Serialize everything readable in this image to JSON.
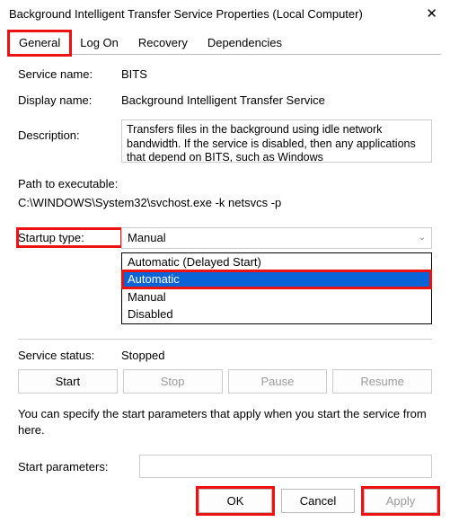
{
  "window": {
    "title": "Background Intelligent Transfer Service Properties (Local Computer)"
  },
  "tabs": {
    "general": "General",
    "logon": "Log On",
    "recovery": "Recovery",
    "dependencies": "Dependencies"
  },
  "labels": {
    "service_name": "Service name:",
    "display_name": "Display name:",
    "description": "Description:",
    "path_header": "Path to executable:",
    "startup_type": "Startup type:",
    "service_status": "Service status:",
    "hint": "You can specify the start parameters that apply when you start the service from here.",
    "start_parameters": "Start parameters:"
  },
  "values": {
    "service_name": "BITS",
    "display_name": "Background Intelligent Transfer Service",
    "description": "Transfers files in the background using idle network bandwidth. If the service is disabled, then any applications that depend on BITS, such as Windows",
    "path": "C:\\WINDOWS\\System32\\svchost.exe -k netsvcs -p",
    "startup_selected": "Manual",
    "service_status": "Stopped",
    "start_parameters": ""
  },
  "startup_options": {
    "delayed": "Automatic (Delayed Start)",
    "automatic": "Automatic",
    "manual": "Manual",
    "disabled": "Disabled"
  },
  "buttons": {
    "start": "Start",
    "stop": "Stop",
    "pause": "Pause",
    "resume": "Resume",
    "ok": "OK",
    "cancel": "Cancel",
    "apply": "Apply"
  }
}
